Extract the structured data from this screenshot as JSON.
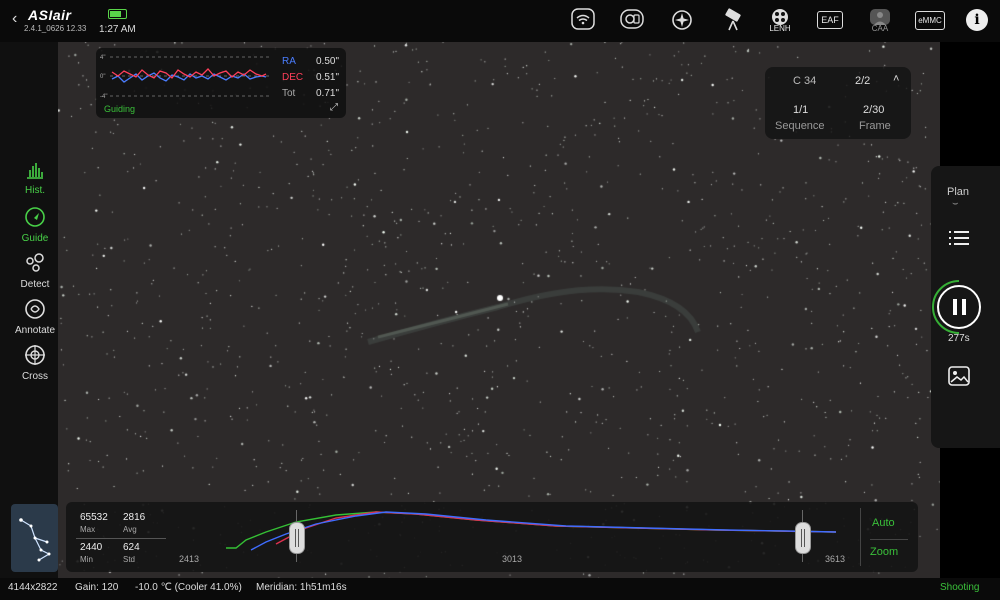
{
  "app": {
    "logo": "ASIair",
    "version": "2.4.1_0626 12.33",
    "time": "1:27 AM"
  },
  "toolbar": {
    "icons": [
      {
        "name": "wifi-icon",
        "label": ""
      },
      {
        "name": "camera-icon",
        "label": ""
      },
      {
        "name": "mount-icon",
        "label": ""
      },
      {
        "name": "telescope-icon",
        "label": ""
      },
      {
        "name": "filter-wheel-icon",
        "label": "LENH"
      },
      {
        "name": "eaf-icon",
        "label": "EAF"
      },
      {
        "name": "caa-icon",
        "label": "CAA"
      },
      {
        "name": "storage-icon",
        "label": "eMMC"
      },
      {
        "name": "info-icon",
        "label": "i"
      }
    ]
  },
  "left_tools": [
    {
      "label": "Hist.",
      "icon": "histogram-icon",
      "active": true
    },
    {
      "label": "Guide",
      "icon": "guide-icon",
      "active": true
    },
    {
      "label": "Detect",
      "icon": "detect-icon",
      "active": false
    },
    {
      "label": "Annotate",
      "icon": "annotate-icon",
      "active": false
    },
    {
      "label": "Cross",
      "icon": "crosshair-icon",
      "active": false
    }
  ],
  "guiding": {
    "ra_label": "RA",
    "ra_value": "0.50\"",
    "dec_label": "DEC",
    "dec_value": "0.51\"",
    "tot_label": "Tot",
    "tot_value": "0.71\"",
    "status": "Guiding",
    "axis_top": "4\"",
    "axis_mid": "0\"",
    "axis_bot": "-4\"",
    "colors": {
      "ra": "#4a7dff",
      "dec": "#ff3f5a",
      "status": "#3ac03a"
    }
  },
  "sequence": {
    "target": "C 34",
    "plan_progress": "2/2",
    "sequence_value": "1/1",
    "sequence_label": "Sequence",
    "frame_value": "2/30",
    "frame_label": "Frame"
  },
  "right_panel": {
    "plan_label": "Plan",
    "countdown": "277s"
  },
  "histogram": {
    "max_value": "65532",
    "max_label": "Max",
    "avg_value": "2816",
    "avg_label": "Avg",
    "min_value": "2440",
    "min_label": "Min",
    "std_value": "624",
    "std_label": "Std",
    "low_tick": "2413",
    "mid_tick": "3013",
    "high_tick": "3613",
    "auto_label": "Auto",
    "zoom_label": "Zoom",
    "stretch_low": 0.07,
    "stretch_high": 0.94
  },
  "status": {
    "resolution": "4144x2822",
    "gain": "Gain: 120",
    "temperature": "-10.0 ℃ (Cooler 41.0%)",
    "meridian": "Meridian: 1h51m16s",
    "state": "Shooting"
  },
  "colors": {
    "accent": "#3ac03a",
    "sky": "#2d2a2a",
    "panel": "#101010"
  }
}
